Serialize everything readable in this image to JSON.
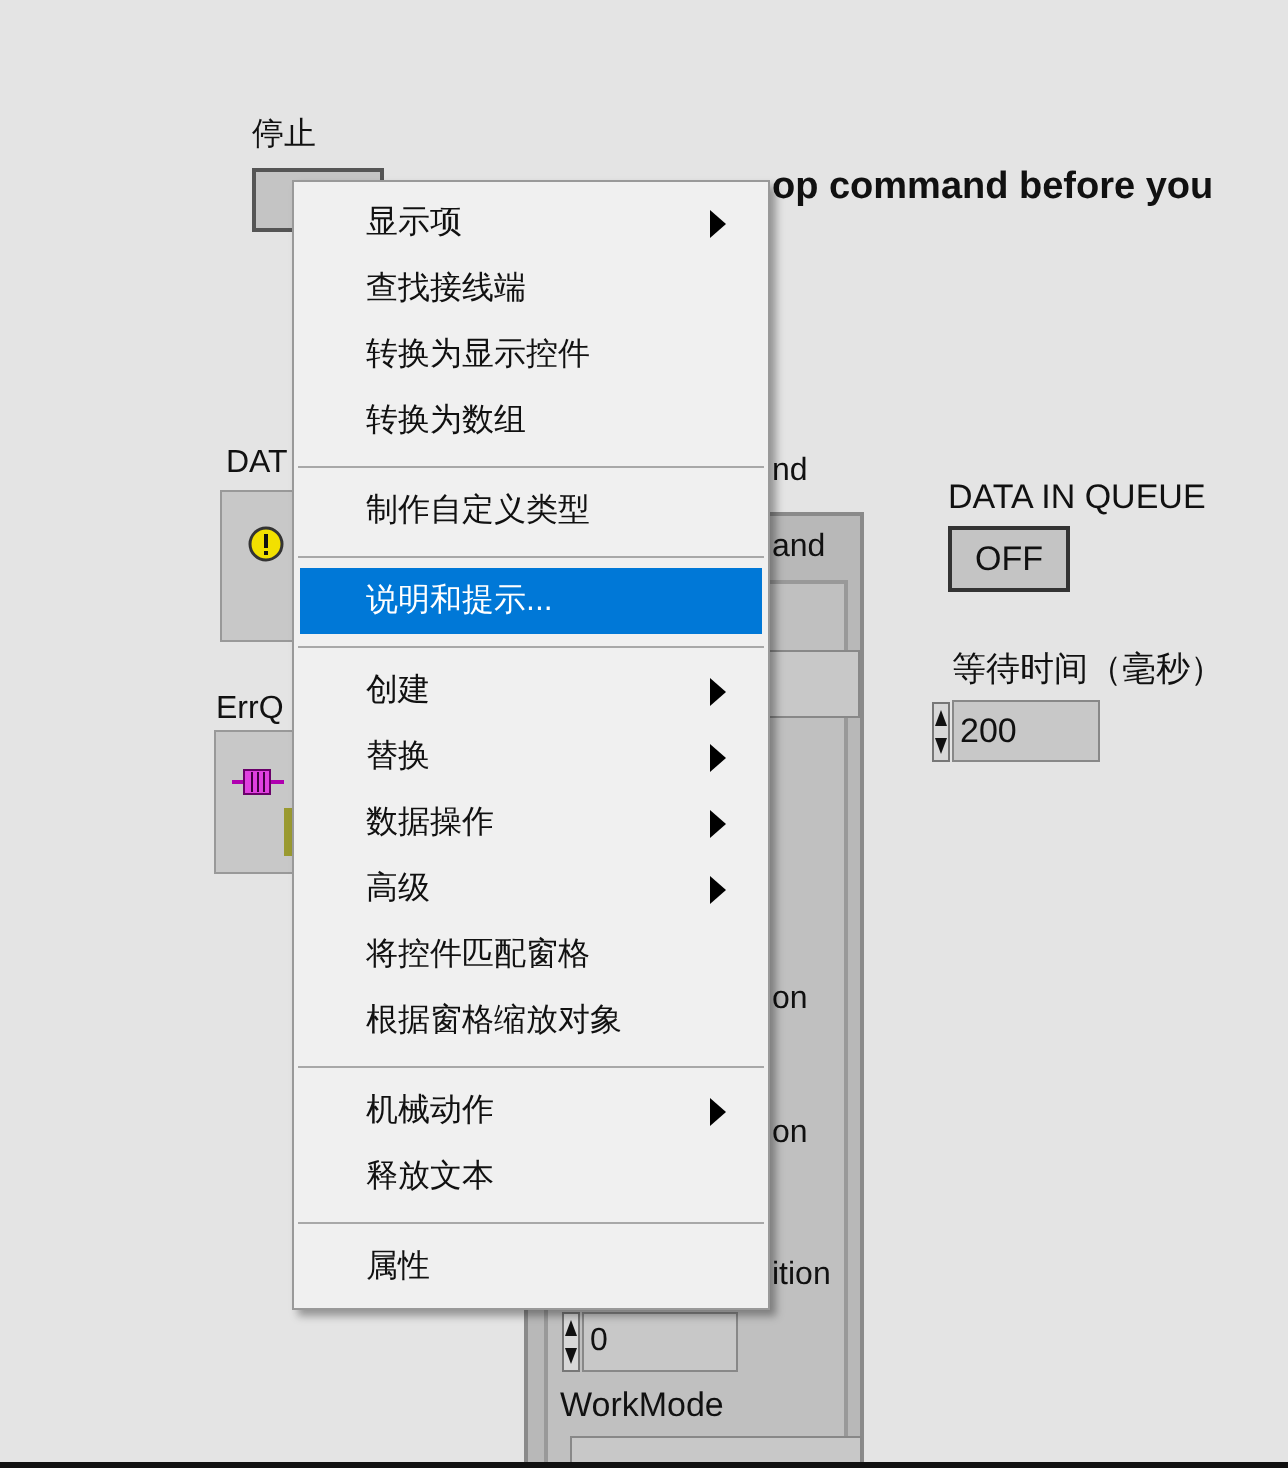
{
  "panel": {
    "stop_label": "停止",
    "message": "op command before you",
    "data_label": "DAT",
    "errq_label": "ErrQ",
    "cluster": {
      "label": "nd",
      "tab": "and",
      "captions": [
        "on",
        "on",
        "ition"
      ],
      "spin_value": "0",
      "workmode_label": "WorkMode"
    },
    "queue": {
      "label": "DATA IN QUEUE",
      "button": "OFF"
    },
    "wait": {
      "label": "等待时间（毫秒）",
      "value": "200"
    }
  },
  "menu": {
    "items": [
      {
        "kind": "item",
        "label": "显示项",
        "submenu": true,
        "selected": false
      },
      {
        "kind": "item",
        "label": "查找接线端",
        "submenu": false,
        "selected": false
      },
      {
        "kind": "item",
        "label": "转换为显示控件",
        "submenu": false,
        "selected": false
      },
      {
        "kind": "item",
        "label": "转换为数组",
        "submenu": false,
        "selected": false
      },
      {
        "kind": "separator"
      },
      {
        "kind": "item",
        "label": "制作自定义类型",
        "submenu": false,
        "selected": false
      },
      {
        "kind": "separator"
      },
      {
        "kind": "item",
        "label": "说明和提示...",
        "submenu": false,
        "selected": true
      },
      {
        "kind": "separator"
      },
      {
        "kind": "item",
        "label": "创建",
        "submenu": true,
        "selected": false
      },
      {
        "kind": "item",
        "label": "替换",
        "submenu": true,
        "selected": false
      },
      {
        "kind": "item",
        "label": "数据操作",
        "submenu": true,
        "selected": false
      },
      {
        "kind": "item",
        "label": "高级",
        "submenu": true,
        "selected": false
      },
      {
        "kind": "item",
        "label": "将控件匹配窗格",
        "submenu": false,
        "selected": false
      },
      {
        "kind": "item",
        "label": "根据窗格缩放对象",
        "submenu": false,
        "selected": false
      },
      {
        "kind": "separator"
      },
      {
        "kind": "item",
        "label": "机械动作",
        "submenu": true,
        "selected": false
      },
      {
        "kind": "item",
        "label": "释放文本",
        "submenu": false,
        "selected": false
      },
      {
        "kind": "separator"
      },
      {
        "kind": "item",
        "label": "属性",
        "submenu": false,
        "selected": false
      }
    ]
  }
}
